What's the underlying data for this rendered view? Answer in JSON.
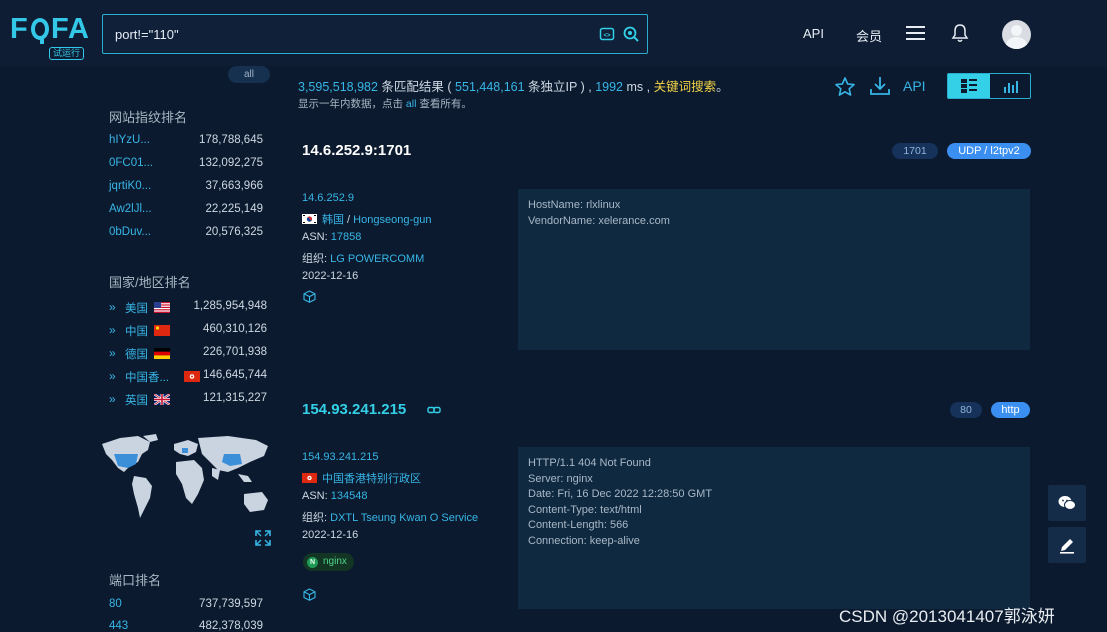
{
  "app": {
    "logo_text": "FOFA",
    "logo_badge": "试运行"
  },
  "search": {
    "value": "port!=\"110\""
  },
  "nav": {
    "api": "API",
    "vip": "会员"
  },
  "sidebar": {
    "all_pill": "all",
    "fingerprint_title": "网站指纹排名",
    "fingerprints": [
      {
        "name": "hIYzU...",
        "count": "178,788,645"
      },
      {
        "name": "0FC01...",
        "count": "132,092,275"
      },
      {
        "name": "jqrtiK0...",
        "count": "37,663,966"
      },
      {
        "name": "Aw2lJl...",
        "count": "22,225,149"
      },
      {
        "name": "0bDuv...",
        "count": "20,576,325"
      }
    ],
    "country_title": "国家/地区排名",
    "countries": [
      {
        "name": "美国",
        "count": "1,285,954,948",
        "flag": "us"
      },
      {
        "name": "中国",
        "count": "460,310,126",
        "flag": "cn"
      },
      {
        "name": "德国",
        "count": "226,701,938",
        "flag": "de"
      },
      {
        "name": "中国香...",
        "count": "146,645,744",
        "flag": "hk"
      },
      {
        "name": "英国",
        "count": "121,315,227",
        "flag": "gb"
      }
    ],
    "port_title": "端口排名",
    "ports": [
      {
        "name": "80",
        "count": "737,739,597"
      },
      {
        "name": "443",
        "count": "482,378,039"
      }
    ]
  },
  "stats": {
    "total": "3,595,518,982",
    "matched_label": " 条匹配结果 ( ",
    "unique_ip": "551,448,161",
    "unique_ip_label": " 条独立IP ) , ",
    "time_ms": "1992",
    "ms_label": " ms , ",
    "keyword_search": "关键词搜索",
    "end_dot": "。",
    "subline_prefix": "显示一年内数据，点击 ",
    "subline_link": "all",
    "subline_suffix": " 查看所有。",
    "api_link": "API"
  },
  "results": [
    {
      "title": "14.6.252.9:1701",
      "port": "1701",
      "protocol": "UDP / l2tpv2",
      "ip": "14.6.252.9",
      "country": "韩国",
      "sep": " / ",
      "city": "Hongseong-gun",
      "flag": "kr",
      "asn_label": "ASN: ",
      "asn": "17858",
      "org_label": "组织: ",
      "org": "LG POWERCOMM",
      "date": "2022-12-16",
      "banner": [
        "HostName: rlxlinux",
        "VendorName: xelerance.com"
      ]
    },
    {
      "title": "154.93.241.215",
      "port": "80",
      "protocol": "http",
      "ip": "154.93.241.215",
      "country": "中国香港特别行政区",
      "flag": "hk",
      "asn_label": "ASN: ",
      "asn": "134548",
      "org_label": "组织: ",
      "org": "DXTL Tseung Kwan O Service",
      "date": "2022-12-16",
      "tag": "nginx",
      "tag_letter": "N",
      "banner": [
        "HTTP/1.1 404 Not Found",
        "Server: nginx",
        "Date: Fri, 16 Dec 2022 12:28:50 GMT",
        "Content-Type: text/html",
        "Content-Length: 566",
        "Connection: keep-alive"
      ]
    }
  ],
  "watermark": "CSDN @2013041407郭泳妍",
  "colors": {
    "background": "#0b1a2e",
    "accent": "#33d0e8",
    "link": "#37b6e6",
    "highlight": "#f5d445",
    "protocol_pill": "#3b8ff0"
  }
}
